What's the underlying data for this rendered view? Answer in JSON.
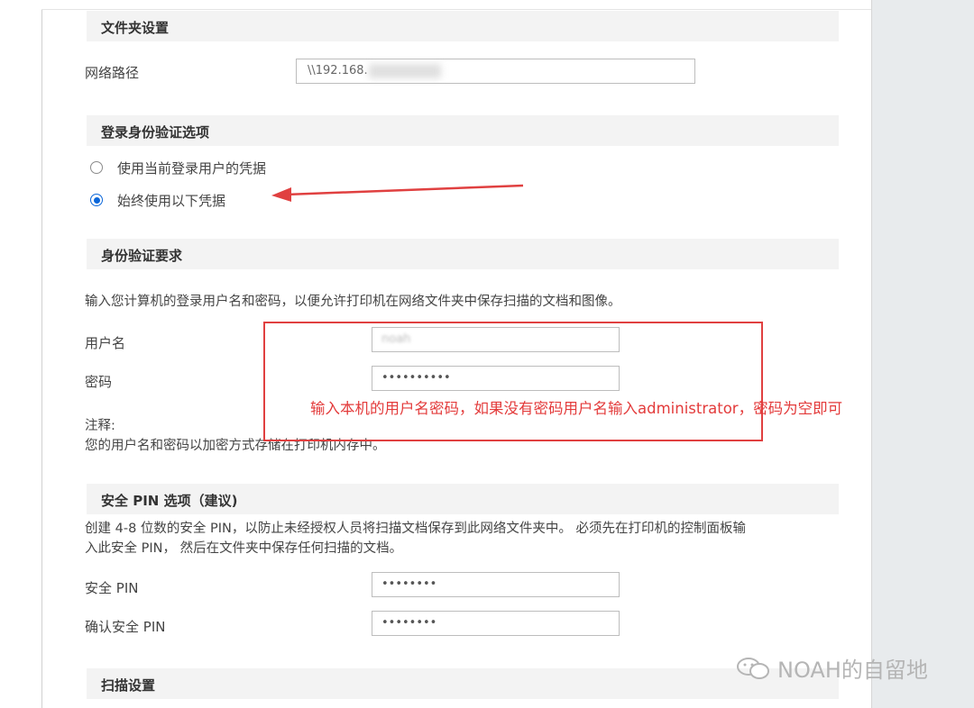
{
  "sections": {
    "folder": "文件夹设置",
    "login": "登录身份验证选项",
    "auth": "身份验证要求",
    "pin": "安全 PIN 选项（建议)",
    "scan": "扫描设置"
  },
  "folder": {
    "network_path_label": "网络路径",
    "network_path_value": "\\\\192.168."
  },
  "login": {
    "option_current": "使用当前登录用户的凭据",
    "option_always": "始终使用以下凭据",
    "selected": "始终使用以下凭据"
  },
  "auth": {
    "description": "输入您计算机的登录用户名和密码，以便允许打印机在网络文件夹中保存扫描的文档和图像。",
    "username_label": "用户名",
    "username_value": "noah",
    "password_label": "密码",
    "password_value": "••••••••••",
    "note_title": "注释:",
    "note_text": "您的用户名和密码以加密方式存储在打印机内存中。"
  },
  "annotation": {
    "text": "输入本机的用户名密码，如果没有密码用户名输入administrator，密码为空即可"
  },
  "pin": {
    "description_line1": "创建 4-8 位数的安全 PIN，以防止未经授权人员将扫描文档保存到此网络文件夹中。 必须先在打印机的控制面板输",
    "description_line2": "入此安全 PIN， 然后在文件夹中保存任何扫描的文档。",
    "pin_label": "安全 PIN",
    "pin_value": "••••••••",
    "confirm_label": "确认安全 PIN",
    "confirm_value": "••••••••"
  },
  "watermark": "NOAH的自留地",
  "colors": {
    "accent": "#0a66d9",
    "annotation_red": "#e04040",
    "section_bg": "#f3f3f3"
  }
}
